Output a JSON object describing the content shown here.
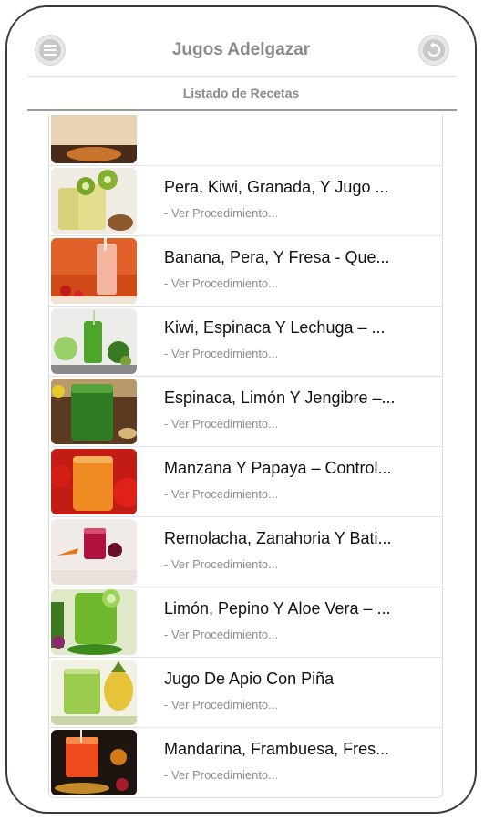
{
  "header": {
    "title": "Jugos Adelgazar",
    "subtitle": "Listado de Recetas",
    "menu_icon": "menu-icon",
    "back_icon": "back-arrow-icon"
  },
  "recipes": [
    {
      "title": "",
      "link": ""
    },
    {
      "title": "Pera, Kiwi, Granada, Y Jugo ...",
      "link": "- Ver Procedimiento..."
    },
    {
      "title": "Banana, Pera, Y Fresa - Que...",
      "link": "- Ver Procedimiento..."
    },
    {
      "title": "Kiwi, Espinaca Y Lechuga – ...",
      "link": "- Ver Procedimiento..."
    },
    {
      "title": "Espinaca, Limón Y Jengibre –...",
      "link": "- Ver Procedimiento..."
    },
    {
      "title": "Manzana Y Papaya – Control...",
      "link": "- Ver Procedimiento..."
    },
    {
      "title": "Remolacha, Zanahoria Y Bati...",
      "link": "- Ver Procedimiento..."
    },
    {
      "title": "Limón, Pepino Y Aloe Vera – ...",
      "link": "- Ver Procedimiento..."
    },
    {
      "title": "Jugo De Apio Con Piña",
      "link": "- Ver Procedimiento..."
    },
    {
      "title": "Mandarina, Frambuesa, Fres...",
      "link": "- Ver Procedimiento..."
    }
  ],
  "colors": {
    "header_text": "#8a8a8a",
    "item_title": "#111111",
    "item_link": "#8d8d8d"
  }
}
